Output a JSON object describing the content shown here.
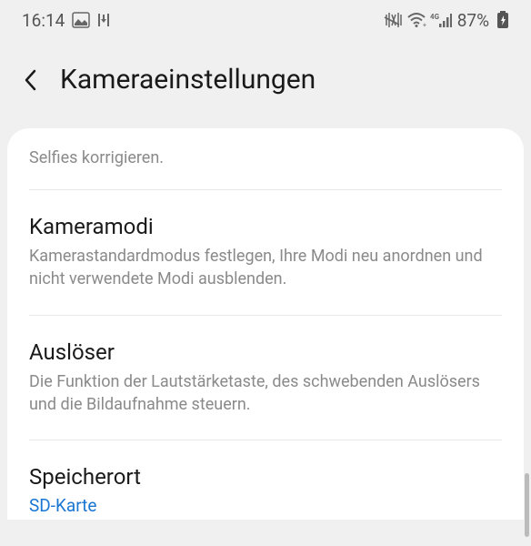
{
  "statusBar": {
    "time": "16:14",
    "batteryPercent": "87%"
  },
  "header": {
    "title": "Kameraeinstellungen"
  },
  "partialItem": {
    "desc": "Selfies korrigieren."
  },
  "settings": {
    "kameramodi": {
      "title": "Kameramodi",
      "desc": "Kamerastandardmodus festlegen, Ihre Modi neu anordnen und nicht verwendete Modi ausblenden."
    },
    "ausloeser": {
      "title": "Auslöser",
      "desc": "Die Funktion der Lautstärketaste, des schwebenden Auslösers und die Bildaufnahme steuern."
    },
    "speicherort": {
      "title": "Speicherort",
      "value": "SD-Karte"
    }
  }
}
